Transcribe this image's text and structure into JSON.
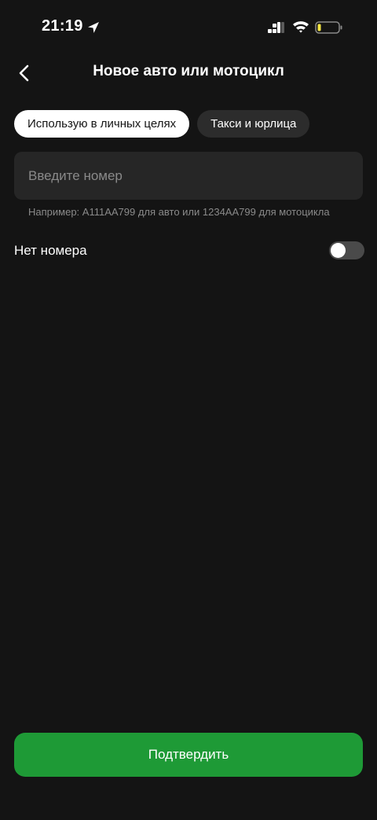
{
  "status_bar": {
    "time": "21:19"
  },
  "header": {
    "title": "Новое авто или мотоцикл"
  },
  "tabs": [
    {
      "label": "Использую в личных целях",
      "active": true
    },
    {
      "label": "Такси и юрлица",
      "active": false
    }
  ],
  "plate_input": {
    "value": "",
    "placeholder": "Введите номер",
    "hint": "Например: А111АА799 для авто или 1234АА799 для мотоцикла"
  },
  "no_plate": {
    "label": "Нет номера",
    "enabled": false
  },
  "confirm_button": {
    "label": "Подтвердить"
  },
  "colors": {
    "background": "#141414",
    "accent": "#1e9a36",
    "input_bg": "#262626",
    "battery_low": "#f5e642"
  }
}
